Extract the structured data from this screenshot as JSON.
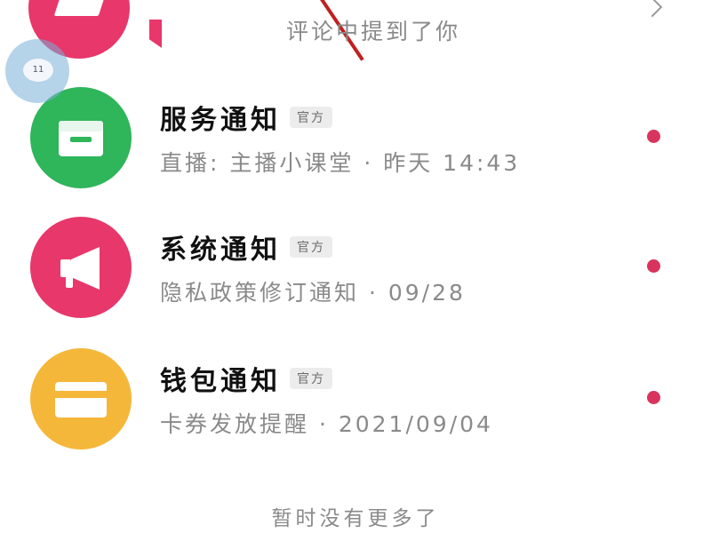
{
  "top_item": {
    "preview": "评论中提到了你",
    "avatar_color": "#e8376a"
  },
  "floating_bubble": {
    "label": "11"
  },
  "notifications": [
    {
      "icon": "inbox-icon",
      "title": "服务通知",
      "badge": "官方",
      "subtitle": "直播: 主播小课堂 · 昨天 14:43",
      "avatar_color": "#2fb55a",
      "unread": true
    },
    {
      "icon": "megaphone-icon",
      "title": "系统通知",
      "badge": "官方",
      "subtitle": "隐私政策修订通知 · 09/28",
      "avatar_color": "#e8376a",
      "unread": true
    },
    {
      "icon": "card-icon",
      "title": "钱包通知",
      "badge": "官方",
      "subtitle": "卡券发放提醒 · 2021/09/04",
      "avatar_color": "#f5b73a",
      "unread": true
    }
  ],
  "colors": {
    "unread_dot": "#d9345d",
    "text_secondary": "#8a8a8a"
  },
  "footer": {
    "text": "暂时没有更多了"
  }
}
